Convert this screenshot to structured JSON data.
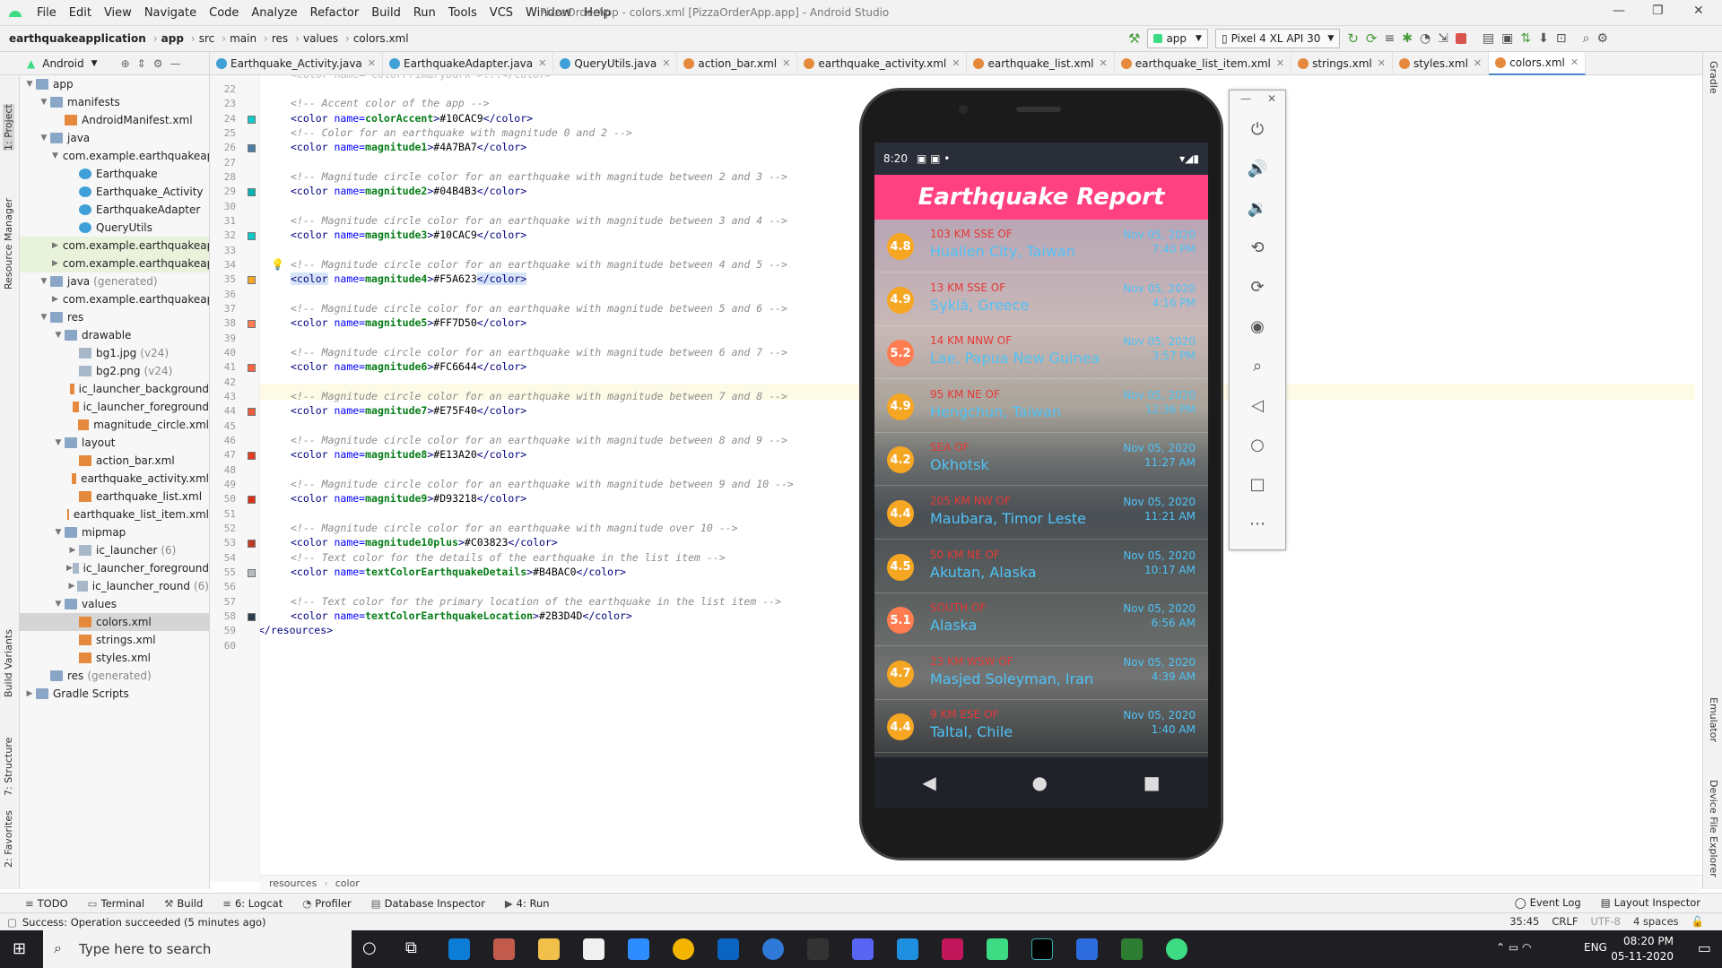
{
  "menubar": {
    "items": [
      "File",
      "Edit",
      "View",
      "Navigate",
      "Code",
      "Analyze",
      "Refactor",
      "Build",
      "Run",
      "Tools",
      "VCS",
      "Window",
      "Help"
    ],
    "title": "PizzaOrderApp - colors.xml [PizzaOrderApp.app] - Android Studio"
  },
  "navbar": {
    "crumbs": [
      "earthquakeapplication",
      "app",
      "src",
      "main",
      "res",
      "values",
      "colors.xml"
    ],
    "run_config": "app",
    "device": "Pixel 4 XL API 30"
  },
  "project_panel": {
    "view": "Android"
  },
  "tabs": [
    "Earthquake_Activity.java",
    "EarthquakeAdapter.java",
    "QueryUtils.java",
    "action_bar.xml",
    "earthquake_activity.xml",
    "earthquake_list.xml",
    "earthquake_list_item.xml",
    "strings.xml",
    "styles.xml",
    "colors.xml"
  ],
  "tree": [
    {
      "label": "app",
      "dim": ""
    },
    {
      "label": "manifests",
      "dim": ""
    },
    {
      "label": "AndroidManifest.xml",
      "dim": ""
    },
    {
      "label": "java",
      "dim": ""
    },
    {
      "label": "com.example.earthquakeapplication",
      "dim": ""
    },
    {
      "label": "Earthquake",
      "dim": ""
    },
    {
      "label": "Earthquake_Activity",
      "dim": ""
    },
    {
      "label": "EarthquakeAdapter",
      "dim": ""
    },
    {
      "label": "QueryUtils",
      "dim": ""
    },
    {
      "label": "com.example.earthquakeapplication",
      "dim": ""
    },
    {
      "label": "com.example.earthquakeapplication",
      "dim": ""
    },
    {
      "label": "java",
      "dim": "(generated)"
    },
    {
      "label": "com.example.earthquakeapplication",
      "dim": ""
    },
    {
      "label": "res",
      "dim": ""
    },
    {
      "label": "drawable",
      "dim": ""
    },
    {
      "label": "bg1.jpg",
      "dim": "(v24)"
    },
    {
      "label": "bg2.png",
      "dim": "(v24)"
    },
    {
      "label": "ic_launcher_background",
      "dim": ""
    },
    {
      "label": "ic_launcher_foreground",
      "dim": ""
    },
    {
      "label": "magnitude_circle.xml",
      "dim": ""
    },
    {
      "label": "layout",
      "dim": ""
    },
    {
      "label": "action_bar.xml",
      "dim": ""
    },
    {
      "label": "earthquake_activity.xml",
      "dim": ""
    },
    {
      "label": "earthquake_list.xml",
      "dim": ""
    },
    {
      "label": "earthquake_list_item.xml",
      "dim": ""
    },
    {
      "label": "mipmap",
      "dim": ""
    },
    {
      "label": "ic_launcher",
      "dim": "(6)"
    },
    {
      "label": "ic_launcher_foreground",
      "dim": ""
    },
    {
      "label": "ic_launcher_round",
      "dim": "(6)"
    },
    {
      "label": "values",
      "dim": ""
    },
    {
      "label": "colors.xml",
      "dim": ""
    },
    {
      "label": "strings.xml",
      "dim": ""
    },
    {
      "label": "styles.xml",
      "dim": ""
    },
    {
      "label": "res",
      "dim": "(generated)"
    },
    {
      "label": "Gradle Scripts",
      "dim": ""
    }
  ],
  "code_lines": [
    {
      "n": "22",
      "t": "",
      "k": "blank"
    },
    {
      "n": "23",
      "t": "<!-- Accent color of the app -->",
      "k": "com"
    },
    {
      "n": "24",
      "name": "colorAccent",
      "val": "#10CAC9",
      "k": "color",
      "swatch": "#10CAC9"
    },
    {
      "n": "25",
      "t": "<!-- Color for an earthquake with magnitude 0 and 2 -->",
      "k": "com"
    },
    {
      "n": "26",
      "name": "magnitude1",
      "val": "#4A7BA7",
      "k": "color",
      "swatch": "#4A7BA7"
    },
    {
      "n": "27",
      "t": "",
      "k": "blank"
    },
    {
      "n": "28",
      "t": "<!-- Magnitude circle color for an earthquake with magnitude between 2 and 3 -->",
      "k": "com"
    },
    {
      "n": "29",
      "name": "magnitude2",
      "val": "#04B4B3",
      "k": "color",
      "swatch": "#04B4B3"
    },
    {
      "n": "30",
      "t": "",
      "k": "blank"
    },
    {
      "n": "31",
      "t": "<!-- Magnitude circle color for an earthquake with magnitude between 3 and 4 -->",
      "k": "com"
    },
    {
      "n": "32",
      "name": "magnitude3",
      "val": "#10CAC9",
      "k": "color",
      "swatch": "#10CAC9"
    },
    {
      "n": "33",
      "t": "",
      "k": "blank"
    },
    {
      "n": "34",
      "t": "<!-- Magnitude circle color for an earthquake with magnitude between 4 and 5 -->",
      "k": "com"
    },
    {
      "n": "35",
      "name": "magnitude4",
      "val": "#F5A623",
      "k": "color",
      "swatch": "#F5A623"
    },
    {
      "n": "36",
      "t": "",
      "k": "blank"
    },
    {
      "n": "37",
      "t": "<!-- Magnitude circle color for an earthquake with magnitude between 5 and 6 -->",
      "k": "com"
    },
    {
      "n": "38",
      "name": "magnitude5",
      "val": "#FF7D50",
      "k": "color",
      "swatch": "#FF7D50"
    },
    {
      "n": "39",
      "t": "",
      "k": "blank"
    },
    {
      "n": "40",
      "t": "<!-- Magnitude circle color for an earthquake with magnitude between 6 and 7 -->",
      "k": "com"
    },
    {
      "n": "41",
      "name": "magnitude6",
      "val": "#FC6644",
      "k": "color",
      "swatch": "#FC6644"
    },
    {
      "n": "42",
      "t": "",
      "k": "blank"
    },
    {
      "n": "43",
      "t": "<!-- Magnitude circle color for an earthquake with magnitude between 7 and 8 -->",
      "k": "com"
    },
    {
      "n": "44",
      "name": "magnitude7",
      "val": "#E75F40",
      "k": "color",
      "swatch": "#E75F40"
    },
    {
      "n": "45",
      "t": "",
      "k": "blank"
    },
    {
      "n": "46",
      "t": "<!-- Magnitude circle color for an earthquake with magnitude between 8 and 9 -->",
      "k": "com"
    },
    {
      "n": "47",
      "name": "magnitude8",
      "val": "#E13A20",
      "k": "color",
      "swatch": "#E13A20"
    },
    {
      "n": "48",
      "t": "",
      "k": "blank"
    },
    {
      "n": "49",
      "t": "<!-- Magnitude circle color for an earthquake with magnitude between 9 and 10 -->",
      "k": "com"
    },
    {
      "n": "50",
      "name": "magnitude9",
      "val": "#D93218",
      "k": "color",
      "swatch": "#D93218"
    },
    {
      "n": "51",
      "t": "",
      "k": "blank"
    },
    {
      "n": "52",
      "t": "<!-- Magnitude circle color for an earthquake with magnitude over 10 -->",
      "k": "com"
    },
    {
      "n": "53",
      "name": "magnitude10plus",
      "val": "#C03823",
      "k": "color",
      "swatch": "#C03823"
    },
    {
      "n": "54",
      "t": "<!-- Text color for the details of the earthquake in the list item -->",
      "k": "com"
    },
    {
      "n": "55",
      "name": "textColorEarthquakeDetails",
      "val": "#B4BAC0",
      "k": "color",
      "swatch": "#B4BAC0"
    },
    {
      "n": "56",
      "t": "",
      "k": "blank"
    },
    {
      "n": "57",
      "t": "<!-- Text color for the primary location of the earthquake in the list item -->",
      "k": "com"
    },
    {
      "n": "58",
      "name": "textColorEarthquakeLocation",
      "val": "#2B3D4D",
      "k": "color",
      "swatch": "#2B3D4D"
    },
    {
      "n": "59",
      "t": "</resources>",
      "k": "tag"
    },
    {
      "n": "60",
      "t": "",
      "k": "blank"
    }
  ],
  "phone": {
    "time": "8:20",
    "app_title": "Earthquake Report",
    "quakes": [
      {
        "mag": "4.8",
        "offset": "103 KM SSE OF",
        "loc": "Hualien City, Taiwan",
        "date": "Nov 05, 2020",
        "time": "7:40 PM",
        "color": "#F5A623"
      },
      {
        "mag": "4.9",
        "offset": "13 KM SSE OF",
        "loc": "Sykiá, Greece",
        "date": "Nov 05, 2020",
        "time": "4:16 PM",
        "color": "#F5A623"
      },
      {
        "mag": "5.2",
        "offset": "14 KM NNW OF",
        "loc": "Lae, Papua New Guinea",
        "date": "Nov 05, 2020",
        "time": "3:57 PM",
        "color": "#FF7D50"
      },
      {
        "mag": "4.9",
        "offset": "95 KM NE OF",
        "loc": "Hengchun, Taiwan",
        "date": "Nov 05, 2020",
        "time": "12:36 PM",
        "color": "#F5A623"
      },
      {
        "mag": "4.2",
        "offset": "SEA OF",
        "loc": "Okhotsk",
        "date": "Nov 05, 2020",
        "time": "11:27 AM",
        "color": "#F5A623"
      },
      {
        "mag": "4.4",
        "offset": "205 KM NW OF",
        "loc": "Maubara, Timor Leste",
        "date": "Nov 05, 2020",
        "time": "11:21 AM",
        "color": "#F5A623"
      },
      {
        "mag": "4.5",
        "offset": "50 KM NE OF",
        "loc": "Akutan, Alaska",
        "date": "Nov 05, 2020",
        "time": "10:17 AM",
        "color": "#F5A623"
      },
      {
        "mag": "5.1",
        "offset": "SOUTH OF",
        "loc": "Alaska",
        "date": "Nov 05, 2020",
        "time": "6:56 AM",
        "color": "#FF7D50"
      },
      {
        "mag": "4.7",
        "offset": "23 KM WSW OF",
        "loc": "Masjed Soleyman, Iran",
        "date": "Nov 05, 2020",
        "time": "4:39 AM",
        "color": "#F5A623"
      },
      {
        "mag": "4.4",
        "offset": "9 KM ESE OF",
        "loc": "Taltal, Chile",
        "date": "Nov 05, 2020",
        "time": "1:40 AM",
        "color": "#F5A623"
      }
    ]
  },
  "left_strip": [
    "1: Project",
    "Resource Manager",
    "Build Variants",
    "7: Structure",
    "2: Favorites"
  ],
  "right_strip": [
    "Gradle",
    "Emulator",
    "Device File Explorer"
  ],
  "editor_crumb": [
    "resources",
    "color"
  ],
  "bottom_tools": [
    "TODO",
    "Terminal",
    "Build",
    "6: Logcat",
    "Profiler",
    "Database Inspector",
    "4: Run"
  ],
  "bottom_tools_right": [
    "Event Log",
    "Layout Inspector"
  ],
  "status": {
    "message": "Success: Operation succeeded (5 minutes ago)",
    "pos": "35:45",
    "eol": "CRLF",
    "enc": "UTF-8",
    "indent": "4 spaces"
  },
  "taskbar": {
    "search": "Type here to search",
    "lang": "ENG",
    "time": "08:20 PM",
    "date": "05-11-2020"
  }
}
